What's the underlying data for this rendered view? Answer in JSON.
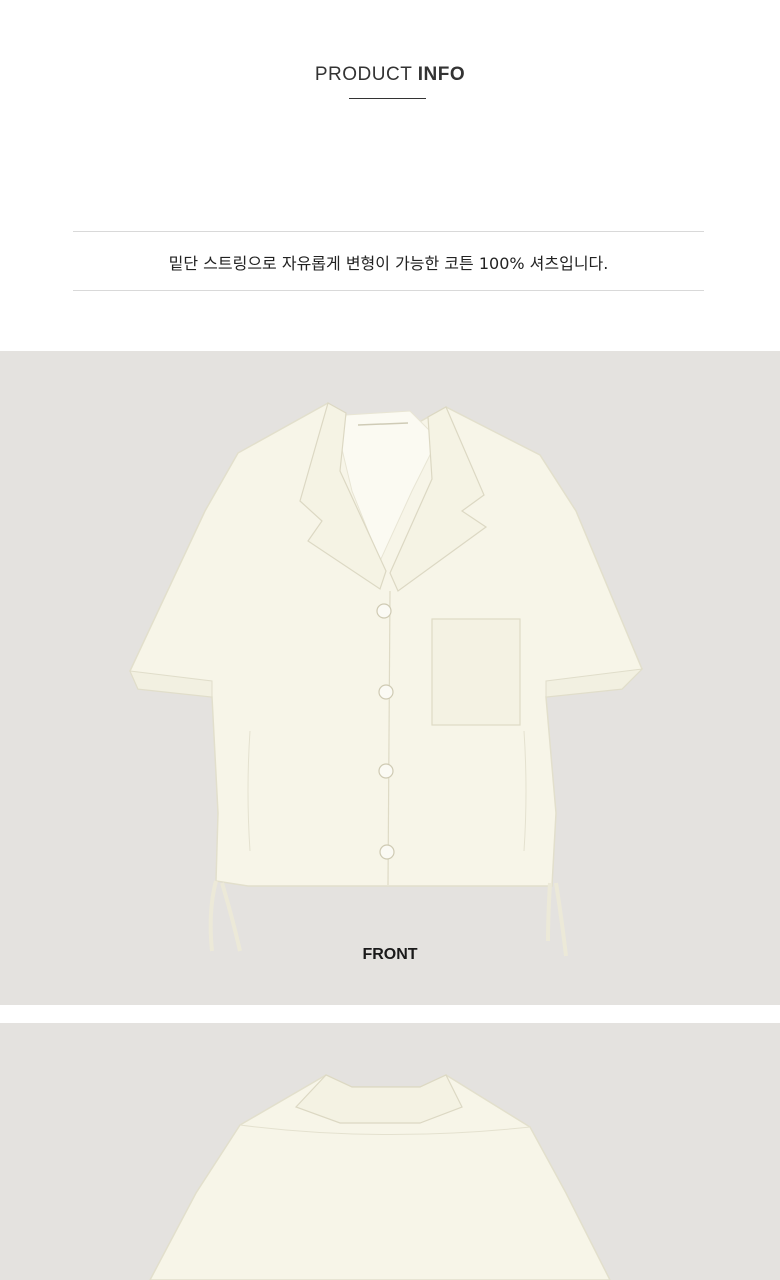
{
  "header": {
    "title_light": "PRODUCT",
    "title_bold": "INFO"
  },
  "description": "밑단 스트링으로 자유롭게 변형이 가능한 코튼 100% 셔츠입니다.",
  "images": [
    {
      "label": "FRONT",
      "subject": "cream short-sleeve open-collar shirt, front view"
    },
    {
      "label": "",
      "subject": "cream short-sleeve open-collar shirt, back view (cropped)"
    }
  ],
  "colors": {
    "background": "#ffffff",
    "photo_background": "#e4e2df",
    "shirt": "#f7f5e8",
    "divider": "#d9d9d9",
    "text": "#222222"
  }
}
